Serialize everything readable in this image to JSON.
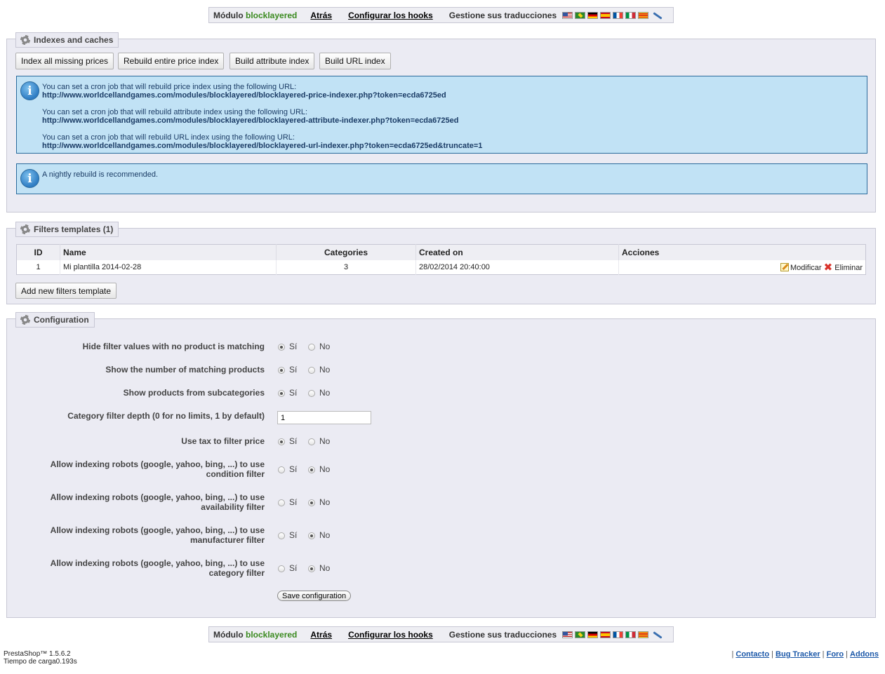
{
  "toolbar": {
    "module_prefix": "Módulo",
    "module_name": "blocklayered",
    "back": "Atrás",
    "hooks": "Configurar los hooks",
    "translations": "Gestione sus traducciones",
    "flags": [
      "us-flag",
      "br-flag",
      "de-flag",
      "es-flag",
      "fr-flag",
      "it-flag",
      "ca-flag"
    ]
  },
  "indexes": {
    "legend": "Indexes and caches",
    "buttons": [
      "Index all missing prices",
      "Rebuild entire price index",
      "Build attribute index",
      "Build URL index"
    ],
    "cron": [
      {
        "text": "You can set a cron job that will rebuild price index using the following URL:",
        "url": "http://www.worldcellandgames.com/modules/blocklayered/blocklayered-price-indexer.php?token=ecda6725ed"
      },
      {
        "text": "You can set a cron job that will rebuild attribute index using the following URL:",
        "url": "http://www.worldcellandgames.com/modules/blocklayered/blocklayered-attribute-indexer.php?token=ecda6725ed"
      },
      {
        "text": "You can set a cron job that will rebuild URL index using the following URL:",
        "url": "http://www.worldcellandgames.com/modules/blocklayered/blocklayered-url-indexer.php?token=ecda6725ed&truncate=1"
      }
    ],
    "nightly": "A nightly rebuild is recommended."
  },
  "templates": {
    "legend": "Filters templates (1)",
    "headers": {
      "id": "ID",
      "name": "Name",
      "categories": "Categories",
      "created": "Created on",
      "actions": "Acciones"
    },
    "rows": [
      {
        "id": "1",
        "name": "Mi plantilla 2014-02-28",
        "categories": "3",
        "created": "28/02/2014 20:40:00",
        "edit": "Modificar",
        "delete": "Eliminar"
      }
    ],
    "add_button": "Add new filters template"
  },
  "config": {
    "legend": "Configuration",
    "yes": "Sí",
    "no": "No",
    "hide_values": {
      "label": "Hide filter values with no product is matching",
      "value": "yes"
    },
    "show_count": {
      "label": "Show the number of matching products",
      "value": "yes"
    },
    "show_subcat": {
      "label": "Show products from subcategories",
      "value": "yes"
    },
    "depth": {
      "label": "Category filter depth (0 for no limits, 1 by default)",
      "value": "1"
    },
    "use_tax": {
      "label": "Use tax to filter price",
      "value": "yes"
    },
    "robots_condition": {
      "label": "Allow indexing robots (google, yahoo, bing, ...) to use condition filter",
      "value": "no"
    },
    "robots_availability": {
      "label": "Allow indexing robots (google, yahoo, bing, ...) to use availability filter",
      "value": "no"
    },
    "robots_manufacturer": {
      "label": "Allow indexing robots (google, yahoo, bing, ...) to use manufacturer filter",
      "value": "no"
    },
    "robots_category": {
      "label": "Allow indexing robots (google, yahoo, bing, ...) to use category filter",
      "value": "no"
    },
    "save": "Save configuration"
  },
  "footer": {
    "version": "PrestaShop™ 1.5.6.2",
    "load_time": "Tiempo de carga0.193s",
    "links": [
      "Contacto",
      "Bug Tracker",
      "Foro",
      "Addons"
    ]
  }
}
